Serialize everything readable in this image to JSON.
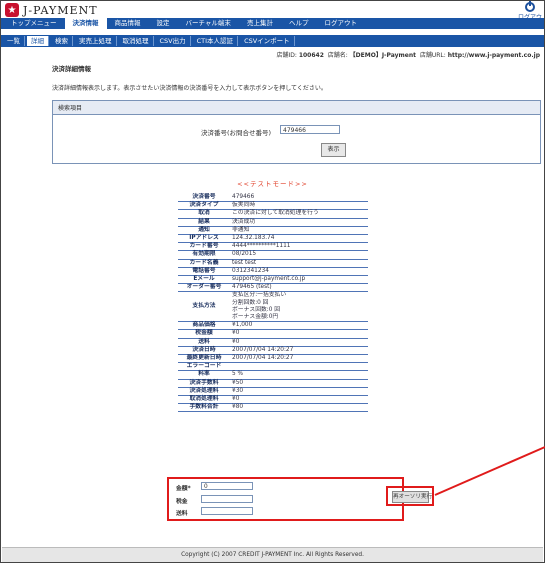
{
  "brand": {
    "logo_text": "J-PAYMENT"
  },
  "logout_top": {
    "label": "ログアウ"
  },
  "menu": [
    {
      "label": "トップメニュー",
      "active": false
    },
    {
      "label": "決済情報",
      "active": true
    },
    {
      "label": "商品情報",
      "active": false
    },
    {
      "label": "設定",
      "active": false
    },
    {
      "label": "バーチャル端末",
      "active": false
    },
    {
      "label": "売上集計",
      "active": false
    },
    {
      "label": "ヘルプ",
      "active": false
    },
    {
      "label": "ログアウト",
      "active": false
    }
  ],
  "submenu": [
    {
      "label": "一覧",
      "active": false
    },
    {
      "label": "詳細",
      "active": true
    },
    {
      "label": "検索",
      "active": false
    },
    {
      "label": "実売上処理",
      "active": false
    },
    {
      "label": "取消処理",
      "active": false
    },
    {
      "label": "CSV出力",
      "active": false
    },
    {
      "label": "CTI本人認証",
      "active": false
    },
    {
      "label": "CSVインポート",
      "active": false
    }
  ],
  "shop": {
    "id_label": "店舗ID:",
    "id": "100642",
    "name_label": "店舗名:",
    "name": "【DEMO】J-Payment",
    "url_label": "店舗URL:",
    "url": "http://www.j-payment.co.jp"
  },
  "page": {
    "title": "決済詳細情報",
    "description": "決済詳細情報表示します。表示させたい決済情報の決済番号を入力して表示ボタンを押してください。"
  },
  "search": {
    "header": "検索項目",
    "label": "決済番号(お問合せ番号)",
    "value": "479466",
    "button": "表示"
  },
  "test_mode": "<<テストモード>>",
  "details": [
    {
      "k": "決済番号",
      "v": "479466"
    },
    {
      "k": "決済タイプ",
      "v": "仮実同時"
    },
    {
      "k": "取消",
      "v": "この決済に対して取消処理を行う"
    },
    {
      "k": "結果",
      "v": "決済成功"
    },
    {
      "k": "通知",
      "v": "非通知"
    },
    {
      "k": "IPアドレス",
      "v": "124.32.183.74"
    },
    {
      "k": "カード番号",
      "v": "4444**********1111"
    },
    {
      "k": "有効期限",
      "v": "08/2015"
    },
    {
      "k": "カード名義",
      "v": "test test"
    },
    {
      "k": "電話番号",
      "v": "0312341234"
    },
    {
      "k": "Eメール",
      "v": "support@j-payment.co.jp"
    },
    {
      "k": "オーダー番号",
      "v": "479465 (test)"
    },
    {
      "k": "支払方法",
      "v": "支払区分:一括支払い\n分割回数:0 回\nボーナス回数:0 回\nボーナス金額:0円"
    },
    {
      "k": "商品価格",
      "v": "¥1,000"
    },
    {
      "k": "税金額",
      "v": "¥0"
    },
    {
      "k": "送料",
      "v": "¥0"
    },
    {
      "k": "決済日時",
      "v": "2007/07/04 14:20:27"
    },
    {
      "k": "最終更新日時",
      "v": "2007/07/04 14:20:27"
    },
    {
      "k": "エラーコード",
      "v": ""
    },
    {
      "k": "料率",
      "v": "5 %"
    },
    {
      "k": "決済手数料",
      "v": "¥50"
    },
    {
      "k": "決済処理料",
      "v": "¥30"
    },
    {
      "k": "取消処理料",
      "v": "¥0"
    },
    {
      "k": "手数料合計",
      "v": "¥80"
    }
  ],
  "rerun": {
    "amount_label": "金額*",
    "amount_value": "0",
    "tax_label": "税金",
    "tax_value": "",
    "shipping_label": "送料",
    "shipping_value": "",
    "button": "再オーソリ実行"
  },
  "footer": "Copyright (C) 2007 CREDIT J-PAYMENT Inc. All Rights Reserved.",
  "colors": {
    "nav": "#1a55a6",
    "highlight": "#e01b1b",
    "test_mode": "#e0402a"
  }
}
